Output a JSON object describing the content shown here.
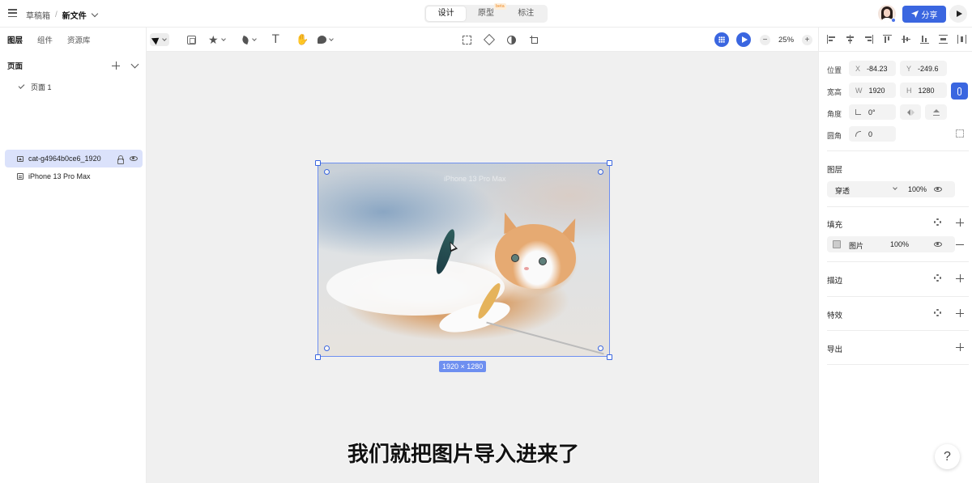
{
  "topbar": {
    "breadcrumb_parent": "草稿箱",
    "breadcrumb_separator": "/",
    "file_name": "新文件",
    "modes": [
      "设计",
      "原型",
      "标注"
    ],
    "active_mode": "设计",
    "beta_badge": "beta",
    "share_label": "分享"
  },
  "left_panel": {
    "tabs": [
      "图层",
      "组件",
      "资源库"
    ],
    "active_tab": "图层",
    "pages_title": "页面",
    "pages": [
      {
        "label": "页面 1",
        "current": true
      }
    ],
    "layers": [
      {
        "label": "cat-g4964b0ce6_1920",
        "selected": true
      },
      {
        "label": "iPhone 13 Pro Max",
        "selected": false
      }
    ]
  },
  "toolbar": {
    "zoom_level": "25%",
    "zoom_out": "−",
    "zoom_in": "+"
  },
  "canvas": {
    "frame_watermark": "iPhone 13 Pro Max",
    "dimension_label": "1920 × 1280",
    "subtitle": "我们就把图片导入进来了"
  },
  "right_panel": {
    "position_label": "位置",
    "x_prefix": "X",
    "x_value": "-84.23",
    "y_prefix": "Y",
    "y_value": "-249.6",
    "size_label": "宽高",
    "w_prefix": "W",
    "w_value": "1920",
    "h_prefix": "H",
    "h_value": "1280",
    "angle_label": "角度",
    "angle_value": "0°",
    "radius_label": "圆角",
    "radius_value": "0",
    "layer_title": "图层",
    "blend_mode": "穿透",
    "layer_opacity": "100%",
    "fill_title": "填充",
    "fill_type": "图片",
    "fill_opacity": "100%",
    "stroke_title": "描边",
    "effects_title": "特效",
    "export_title": "导出",
    "help_label": "?"
  },
  "colors": {
    "accent": "#3a66e0",
    "selection": "#6e8ff0",
    "selected_layer_bg": "#dbe2fb",
    "canvas_bg": "#f0f0f0"
  }
}
